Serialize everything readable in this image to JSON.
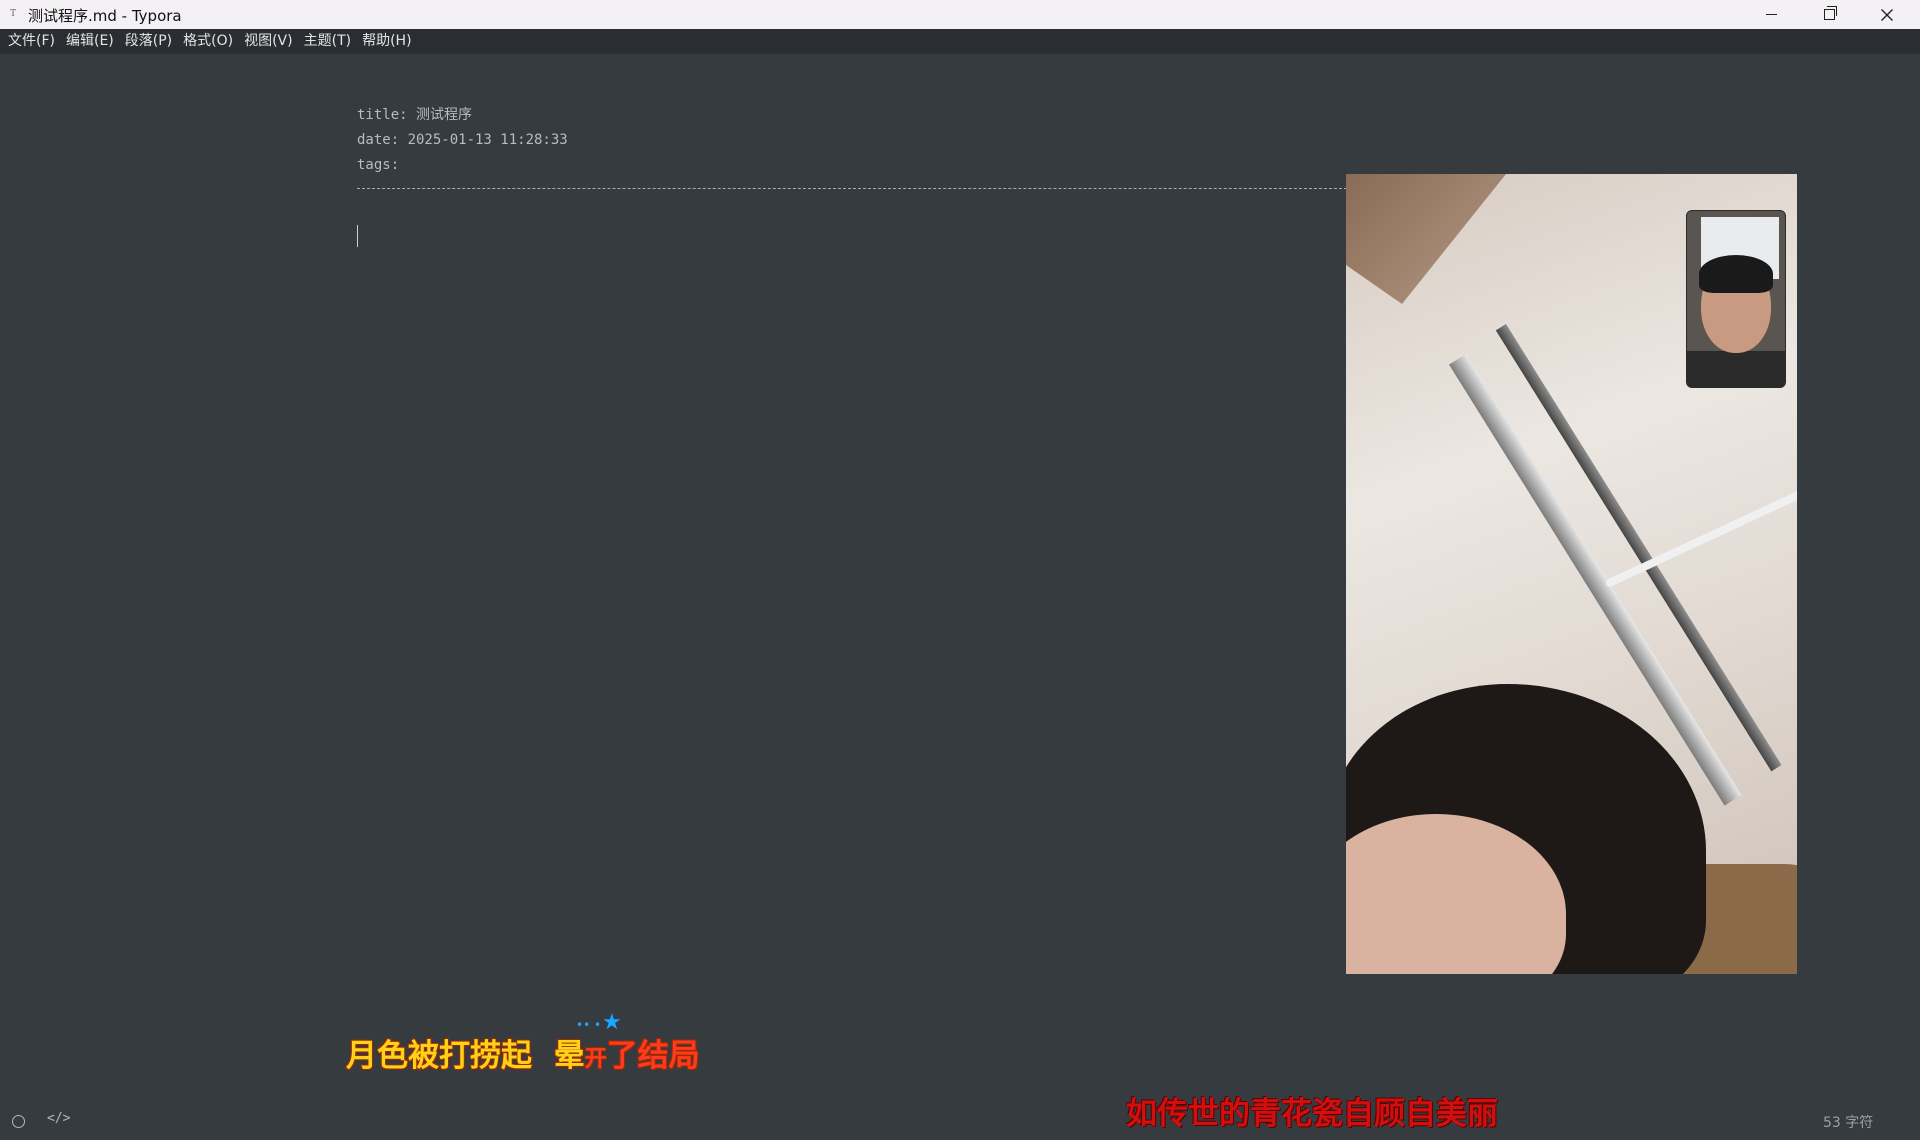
{
  "window": {
    "title": "测试程序.md - Typora",
    "app_icon": "T",
    "controls": {
      "minimize": "minimize-icon",
      "restore": "restore-icon",
      "close": "close-icon"
    }
  },
  "menu": [
    "文件(F)",
    "编辑(E)",
    "段落(P)",
    "格式(O)",
    "视图(V)",
    "主题(T)",
    "帮助(H)"
  ],
  "editor": {
    "frontmatter": {
      "title_line": "title: 测试程序",
      "date_line": "date: 2025-01-13 11:28:33",
      "tags_line": "tags:"
    }
  },
  "lyrics": {
    "line1_a": "月色被打捞起  晕",
    "line1_b": "开",
    "line1_c": "了结局",
    "line2": "如传世的青花瓷自顾自美丽"
  },
  "status": {
    "word_count": "53 字符"
  },
  "colors": {
    "editor_bg": "#363b40",
    "menu_bg": "#2a2d31",
    "lyric_yellow": "#ffd21a",
    "lyric_red": "#d20f0f"
  }
}
